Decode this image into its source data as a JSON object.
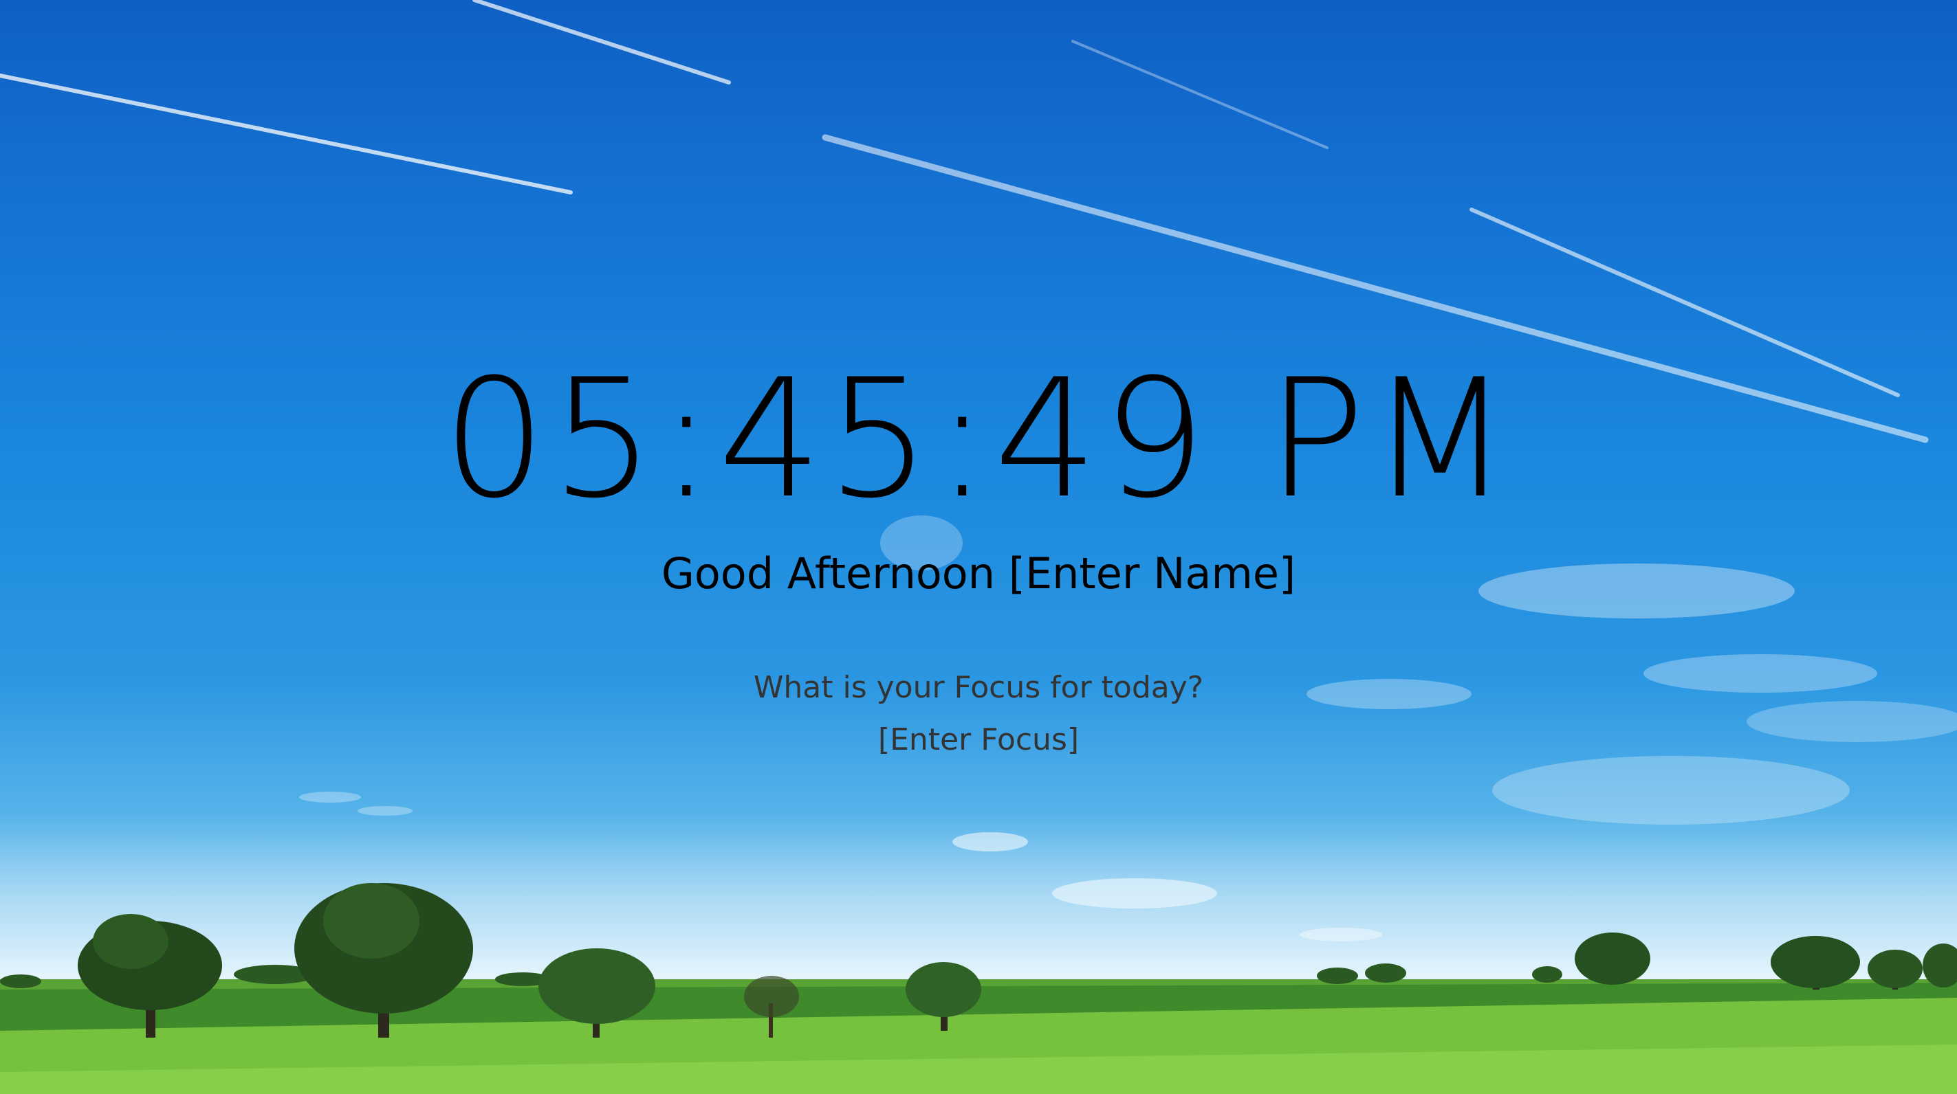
{
  "clock": {
    "time": "05:45:49 PM"
  },
  "greeting": {
    "prefix": "Good Afternoon",
    "name_placeholder": "[Enter Name]"
  },
  "focus": {
    "question": "What is your Focus for today?",
    "input_placeholder": "[Enter Focus]"
  },
  "colors": {
    "clock_text": "#000000",
    "greeting_text": "#000000",
    "focus_text": "#333333",
    "sky": "#1a86dd",
    "grass": "#6cbf3a"
  }
}
